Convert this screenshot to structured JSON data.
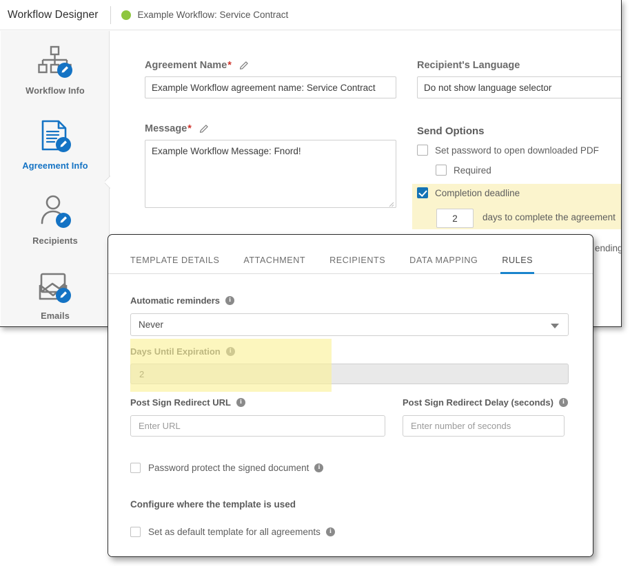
{
  "window": {
    "app_title": "Workflow Designer",
    "workflow_name": "Example Workflow: Service Contract",
    "status_color": "#8ec63f"
  },
  "sidebar": {
    "items": [
      {
        "label": "Workflow Info",
        "icon": "org-chart-edit-icon",
        "active": false
      },
      {
        "label": "Agreement Info",
        "icon": "document-edit-icon",
        "active": true
      },
      {
        "label": "Recipients",
        "icon": "person-edit-icon",
        "active": false
      },
      {
        "label": "Emails",
        "icon": "email-image-edit-icon",
        "active": false
      }
    ]
  },
  "form": {
    "agreement_name": {
      "label": "Agreement Name",
      "required_mark": "*",
      "value": "Example Workflow agreement name: Service Contract"
    },
    "message": {
      "label": "Message",
      "required_mark": "*",
      "value": "Example Workflow Message: Fnord!"
    },
    "recipients_language": {
      "label": "Recipient's Language",
      "value": "Do not show language selector"
    },
    "send_options": {
      "heading": "Send Options",
      "set_password": {
        "label": "Set password to open downloaded PDF",
        "checked": false
      },
      "required": {
        "label": "Required",
        "checked": false
      },
      "completion_deadline": {
        "label": "Completion deadline",
        "checked": true
      },
      "days_value": "2",
      "days_suffix": "days to complete the agreement",
      "clipped_text": "ending"
    }
  },
  "modal": {
    "tabs": [
      {
        "label": "TEMPLATE DETAILS",
        "active": false
      },
      {
        "label": "ATTACHMENT",
        "active": false
      },
      {
        "label": "RECIPIENTS",
        "active": false
      },
      {
        "label": "DATA MAPPING",
        "active": false
      },
      {
        "label": "RULES",
        "active": true
      }
    ],
    "accent_color": "#1a84cc",
    "automatic_reminders": {
      "label": "Automatic reminders",
      "value": "Never"
    },
    "days_until_expiration": {
      "label": "Days Until Expiration",
      "value": "2"
    },
    "post_sign_redirect_url": {
      "label": "Post Sign Redirect URL",
      "placeholder": "Enter URL",
      "value": ""
    },
    "post_sign_redirect_delay": {
      "label": "Post Sign Redirect Delay (seconds)",
      "placeholder": "Enter number of seconds",
      "value": ""
    },
    "password_protect": {
      "label": "Password protect the signed document",
      "checked": false
    },
    "configure_heading": "Configure where the template is used",
    "set_default_template": {
      "label": "Set as default template for all agreements",
      "checked": false
    }
  },
  "colors": {
    "highlight_yellow": "#fbf4cd",
    "checkbox_blue": "#1473b5",
    "active_nav_blue": "#1473c4"
  }
}
